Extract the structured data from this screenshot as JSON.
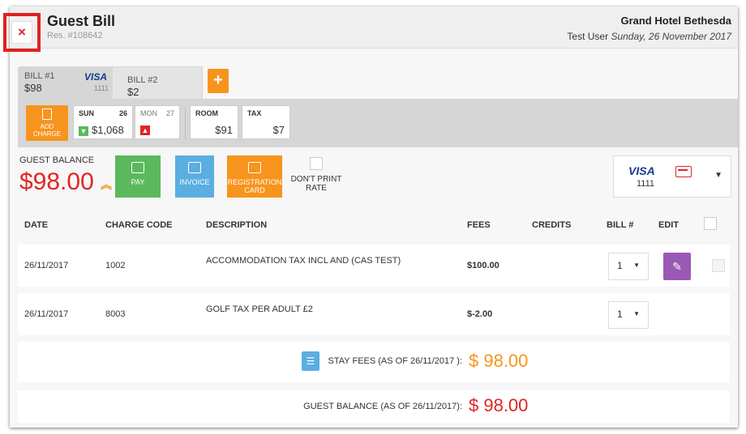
{
  "header": {
    "close_label": "×",
    "title": "Guest Bill",
    "reservation": "Res. #108642",
    "hotel": "Grand Hotel Bethesda",
    "user": "Test User",
    "date": "Sunday, 26 November 2017"
  },
  "bill_tabs": [
    {
      "label": "BILL #1",
      "amount": "$98",
      "card_brand": "VISA",
      "card_last4": "1111"
    },
    {
      "label": "BILL #2",
      "amount": "$2"
    }
  ],
  "add_bill_label": "+",
  "charges_bar": {
    "add_charge_label": "ADD CHARGE",
    "sun": {
      "day": "SUN",
      "date": "26",
      "amount": "$1,068"
    },
    "mon": {
      "day": "MON",
      "date": "27"
    },
    "room": {
      "label": "ROOM",
      "amount": "$91"
    },
    "tax": {
      "label": "TAX",
      "amount": "$7"
    }
  },
  "balance": {
    "label": "GUEST BALANCE",
    "amount": "$98.00"
  },
  "actions": {
    "pay": "PAY",
    "invoice": "INVOICE",
    "registration_card": "REGISTRATION CARD",
    "dont_print_rate": "DON'T PRINT RATE"
  },
  "payment_card": {
    "brand": "VISA",
    "last4": "1111"
  },
  "table": {
    "headers": [
      "DATE",
      "CHARGE CODE",
      "DESCRIPTION",
      "FEES",
      "CREDITS",
      "BILL #",
      "EDIT"
    ],
    "rows": [
      {
        "date": "26/11/2017",
        "code": "1002",
        "description": "ACCOMMODATION TAX INCL AND (CAS TEST)",
        "fees": "$100.00",
        "credits": "",
        "bill": "1"
      },
      {
        "date": "26/11/2017",
        "code": "8003",
        "description": "GOLF TAX PER ADULT £2",
        "fees": "$-2.00",
        "credits": "",
        "bill": "1"
      }
    ]
  },
  "summary": {
    "stay_fees_label": "STAY FEES (AS OF 26/11/2017 ):",
    "stay_fees_value": "$ 98.00",
    "guest_balance_label": "GUEST BALANCE (AS OF 26/11/2017):",
    "guest_balance_value": "$ 98.00"
  },
  "colors": {
    "orange": "#f7941d",
    "red": "#e02525",
    "green": "#5cb85c",
    "blue": "#5aaee0",
    "purple": "#9b59b6"
  }
}
